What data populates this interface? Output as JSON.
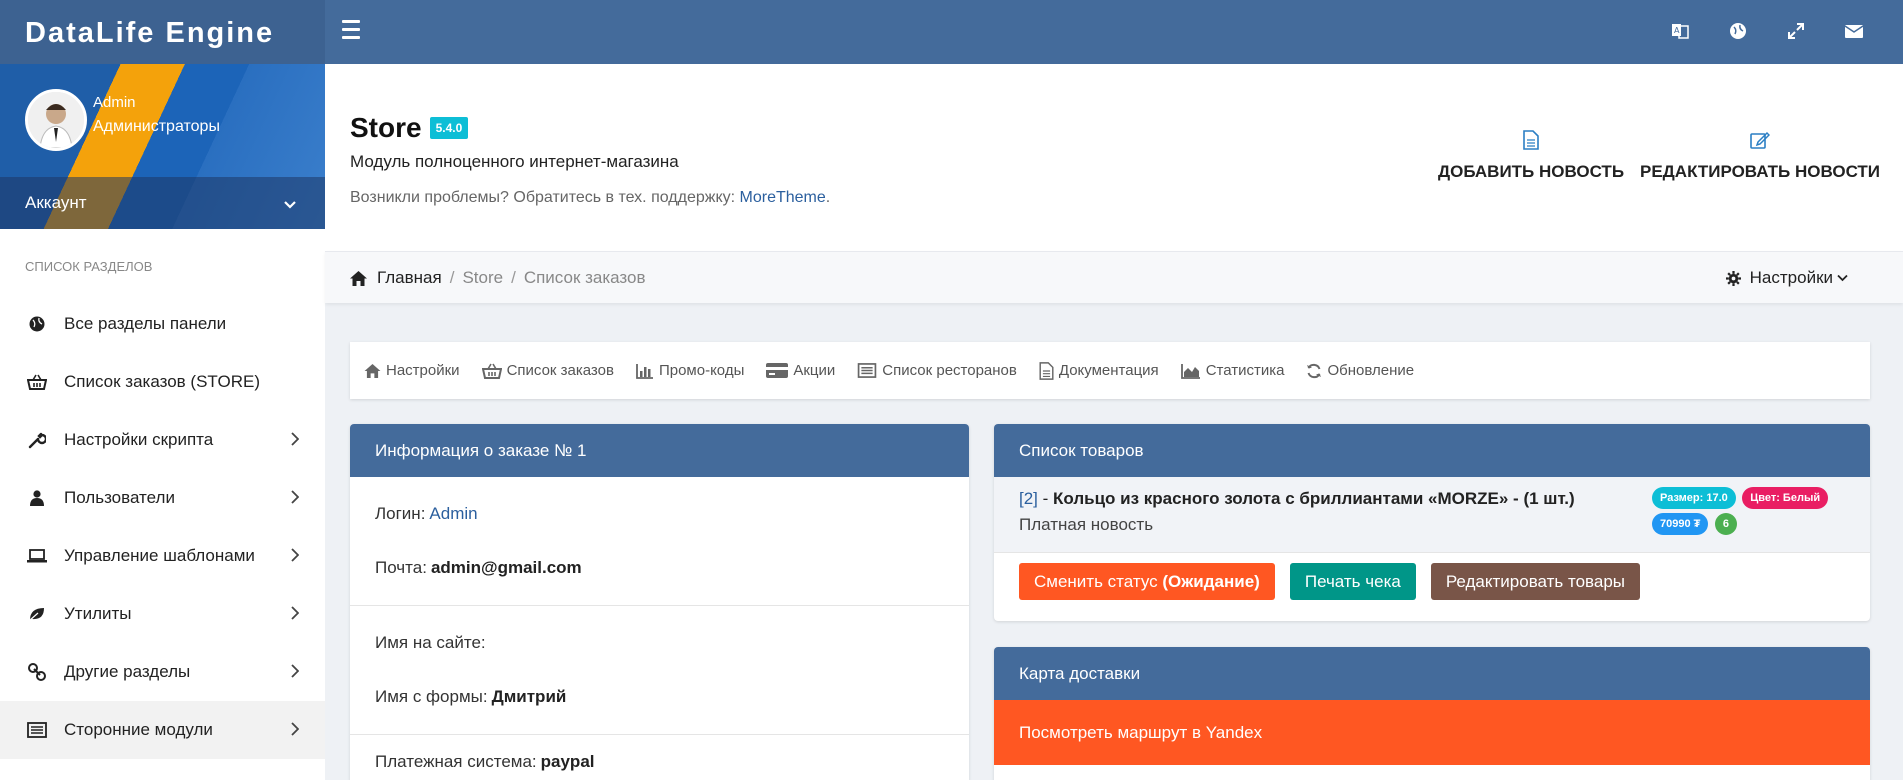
{
  "brand": "DataLife Engine",
  "topbar": {
    "icons": [
      "translate-icon",
      "globe-icon",
      "expand-icon",
      "envelope-icon"
    ]
  },
  "user": {
    "name": "Admin",
    "group": "Администраторы",
    "account_label": "Аккаунт"
  },
  "sidebar": {
    "section_title": "СПИСОК РАЗДЕЛОВ",
    "items": [
      {
        "label": "Все разделы панели",
        "icon": "globe-icon"
      },
      {
        "label": "Список заказов (STORE)",
        "icon": "basket-icon"
      },
      {
        "label": "Настройки скрипта",
        "icon": "wrench-icon"
      },
      {
        "label": "Пользователи",
        "icon": "user-icon"
      },
      {
        "label": "Управление шаблонами",
        "icon": "laptop-icon"
      },
      {
        "label": "Утилиты",
        "icon": "leaf-icon"
      },
      {
        "label": "Другие разделы",
        "icon": "link-icon"
      },
      {
        "label": "Сторонние модули",
        "icon": "list-icon"
      }
    ]
  },
  "header": {
    "title": "Store",
    "version": "5.4.0",
    "subtitle": "Модуль полноценного интернет-магазина",
    "support_text": "Возникли проблемы? Обратитесь в тех. поддержку:",
    "support_link": "MoreTheme",
    "support_dot": ".",
    "add_news": "ДОБАВИТЬ НОВОСТЬ",
    "edit_news": "РЕДАКТИРОВАТЬ НОВОСТИ"
  },
  "breadcrumb": {
    "home": "Главная",
    "store": "Store",
    "current": "Список заказов",
    "settings": "Настройки"
  },
  "modnav": [
    {
      "label": "Настройки",
      "icon": "home-icon"
    },
    {
      "label": "Список заказов",
      "icon": "basket-icon"
    },
    {
      "label": "Промо-коды",
      "icon": "bar-chart-icon"
    },
    {
      "label": "Акции",
      "icon": "credit-card-icon"
    },
    {
      "label": "Список ресторанов",
      "icon": "list-icon"
    },
    {
      "label": "Документация",
      "icon": "document-icon"
    },
    {
      "label": "Статистика",
      "icon": "area-chart-icon"
    },
    {
      "label": "Обновление",
      "icon": "refresh-icon"
    }
  ],
  "order": {
    "title": "Информация о заказе № 1",
    "login_label": "Логин:",
    "login_value": "Admin",
    "email_label": "Почта:",
    "email_value": "admin@gmail.com",
    "site_name_label": "Имя на сайте:",
    "form_name_label": "Имя с формы:",
    "form_name_value": "Дмитрий",
    "payment_label": "Платежная система:",
    "payment_value": "paypal"
  },
  "goods": {
    "title": "Список товаров",
    "item_id": "[2]",
    "item_dash": " - ",
    "item_name": "Кольцо из красного золота с бриллиантами «MORZE» - (1 шт.)",
    "item_sub": "Платная новость",
    "badges": [
      {
        "text": "Размер: 17.0",
        "color": "#0dbed6"
      },
      {
        "text": "Цвет: Белый",
        "color": "#e91e63"
      },
      {
        "text": "70990 ₮",
        "color": "#2196f3"
      },
      {
        "text": "6",
        "color": "#4caf50"
      }
    ],
    "btn_status": "Сменить статус",
    "btn_status_value": "(Ожидание)",
    "btn_print": "Печать чека",
    "btn_edit": "Редактировать товары",
    "colors": {
      "status": "#ff5722",
      "print": "#009688",
      "edit": "#795548"
    }
  },
  "delivery": {
    "title": "Карта доставки",
    "route_btn": "Посмотреть маршрут в Yandex"
  }
}
